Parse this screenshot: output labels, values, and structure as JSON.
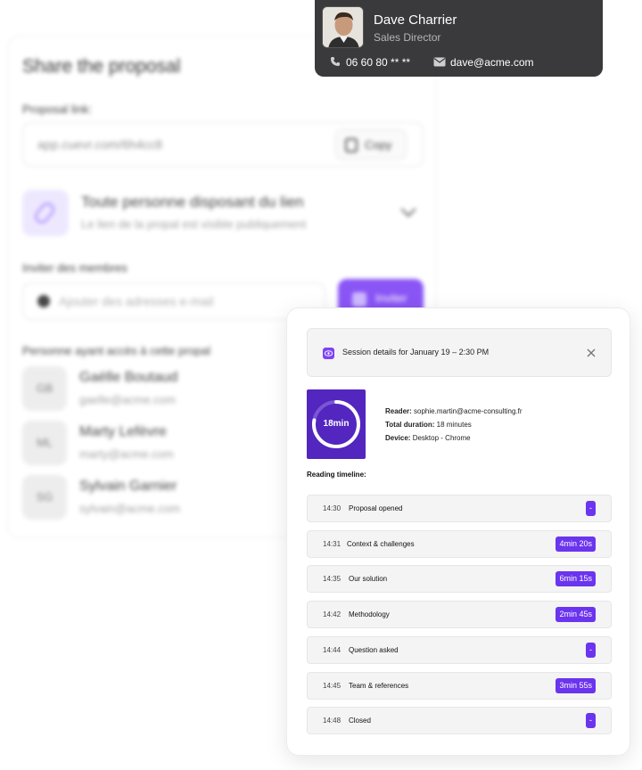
{
  "share_panel": {
    "title": "Share the proposal",
    "link_label": "Proposal link:",
    "link_value": "app.cuevr.com/6h4cc8",
    "copy_label": "Copy",
    "access_title": "Toute personne disposant du lien",
    "access_subtitle": "Le lien de la propal est visible publiquement",
    "invite_label": "Inviter des membres",
    "invite_placeholder": "Ajouter des adresses e-mail",
    "invite_button": "Inviter",
    "members_label": "Personne ayant accès à cette propal",
    "members": [
      {
        "initials": "GB",
        "name": "Gaëlle Boutaud",
        "email": "gaelle@acme.com"
      },
      {
        "initials": "ML",
        "name": "Marty Lefèvre",
        "email": "marty@acme.com"
      },
      {
        "initials": "SG",
        "name": "Sylvain Garnier",
        "email": "sylvain@acme.com"
      }
    ]
  },
  "contact": {
    "name": "Dave Charrier",
    "role": "Sales Director",
    "phone": "06 60 80 **  **",
    "email": "dave@acme.com"
  },
  "session": {
    "header": "Session details for January 19 – 2:30 PM",
    "duration_label": "18min",
    "reader_key": "Reader:",
    "reader_value": "sophie.martin@acme-consulting.fr",
    "total_key": "Total duration:",
    "total_value": "18 minutes",
    "device_key": "Device:",
    "device_value": "Desktop - Chrome",
    "timeline_title": "Reading timeline:",
    "timeline": [
      {
        "time": "14:30",
        "label": "Proposal opened",
        "badge": "-"
      },
      {
        "time": "14:31",
        "label": "Context & challenges",
        "badge": "4min 20s"
      },
      {
        "time": "14:35",
        "label": "Our solution",
        "badge": "6min 15s"
      },
      {
        "time": "14:42",
        "label": "Methodology",
        "badge": "2min 45s"
      },
      {
        "time": "14:44",
        "label": "Question asked",
        "badge": "-"
      },
      {
        "time": "14:45",
        "label": "Team & references",
        "badge": "3min 55s"
      },
      {
        "time": "14:48",
        "label": "Closed",
        "badge": "-"
      }
    ]
  },
  "colors": {
    "accent": "#6b34ee",
    "ring_bg": "#5226bf",
    "card_dark": "#3a3a3c"
  }
}
